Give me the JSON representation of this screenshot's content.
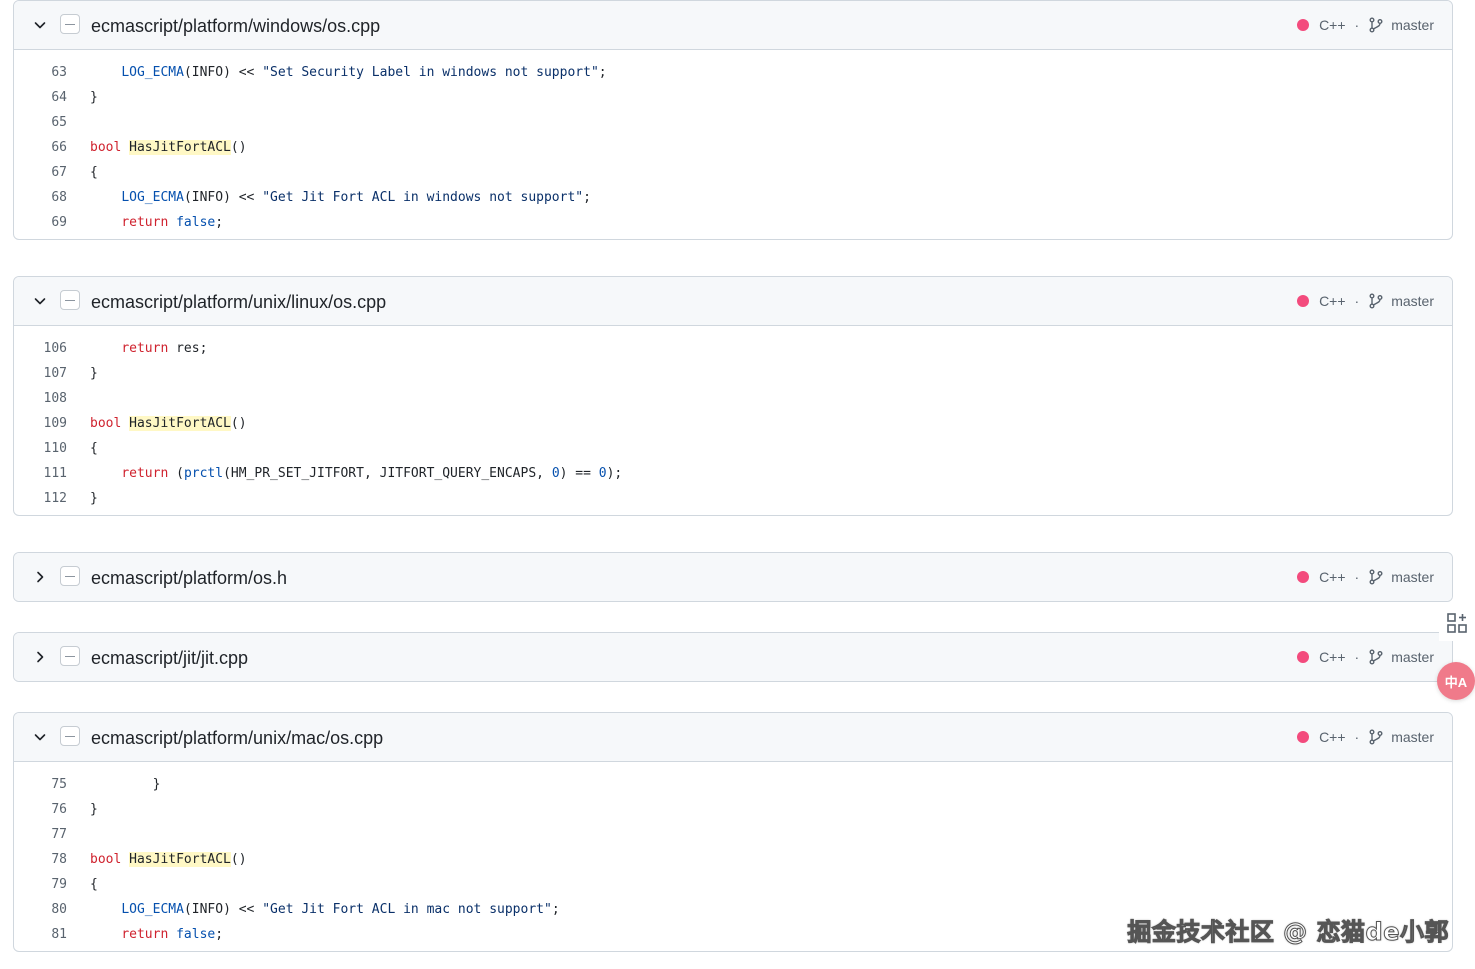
{
  "results": [
    {
      "path": "ecmascript/platform/windows/os.cpp",
      "language": "C++",
      "separator": "·",
      "branch": "master",
      "expanded": true,
      "lines": [
        {
          "n": "63",
          "indent": "    ",
          "tokens": [
            [
              "fn",
              "LOG_ECMA"
            ],
            [
              "",
              "(INFO) << "
            ],
            [
              "str",
              "\"Set Security Label in windows not support\""
            ],
            [
              "",
              ";"
            ]
          ]
        },
        {
          "n": "64",
          "indent": "",
          "tokens": [
            [
              "",
              "}"
            ]
          ]
        },
        {
          "n": "65",
          "indent": "",
          "tokens": []
        },
        {
          "n": "66",
          "indent": "",
          "tokens": [
            [
              "kw",
              "bool"
            ],
            [
              "",
              " "
            ],
            [
              "hl",
              "HasJitFortACL"
            ],
            [
              "",
              "()"
            ]
          ]
        },
        {
          "n": "67",
          "indent": "",
          "tokens": [
            [
              "",
              "{"
            ]
          ]
        },
        {
          "n": "68",
          "indent": "    ",
          "tokens": [
            [
              "fn",
              "LOG_ECMA"
            ],
            [
              "",
              "(INFO) << "
            ],
            [
              "str",
              "\"Get Jit Fort ACL in windows not support\""
            ],
            [
              "",
              ";"
            ]
          ]
        },
        {
          "n": "69",
          "indent": "    ",
          "tokens": [
            [
              "kw",
              "return"
            ],
            [
              "",
              " "
            ],
            [
              "fn",
              "false"
            ],
            [
              "",
              ";"
            ]
          ]
        }
      ]
    },
    {
      "path": "ecmascript/platform/unix/linux/os.cpp",
      "language": "C++",
      "separator": "·",
      "branch": "master",
      "expanded": true,
      "lines": [
        {
          "n": "106",
          "indent": "    ",
          "tokens": [
            [
              "kw",
              "return"
            ],
            [
              "",
              " res;"
            ]
          ]
        },
        {
          "n": "107",
          "indent": "",
          "tokens": [
            [
              "",
              "}"
            ]
          ]
        },
        {
          "n": "108",
          "indent": "",
          "tokens": []
        },
        {
          "n": "109",
          "indent": "",
          "tokens": [
            [
              "kw",
              "bool"
            ],
            [
              "",
              " "
            ],
            [
              "hl",
              "HasJitFortACL"
            ],
            [
              "",
              "()"
            ]
          ]
        },
        {
          "n": "110",
          "indent": "",
          "tokens": [
            [
              "",
              "{"
            ]
          ]
        },
        {
          "n": "111",
          "indent": "    ",
          "tokens": [
            [
              "kw",
              "return"
            ],
            [
              "",
              " ("
            ],
            [
              "fn",
              "prctl"
            ],
            [
              "",
              "(HM_PR_SET_JITFORT, JITFORT_QUERY_ENCAPS, "
            ],
            [
              "num",
              "0"
            ],
            [
              "",
              ") == "
            ],
            [
              "num",
              "0"
            ],
            [
              "",
              ");"
            ]
          ]
        },
        {
          "n": "112",
          "indent": "",
          "tokens": [
            [
              "",
              "}"
            ]
          ]
        }
      ]
    },
    {
      "path": "ecmascript/platform/os.h",
      "language": "C++",
      "separator": "·",
      "branch": "master",
      "expanded": false,
      "lines": []
    },
    {
      "path": "ecmascript/jit/jit.cpp",
      "language": "C++",
      "separator": "·",
      "branch": "master",
      "expanded": false,
      "lines": []
    },
    {
      "path": "ecmascript/platform/unix/mac/os.cpp",
      "language": "C++",
      "separator": "·",
      "branch": "master",
      "expanded": true,
      "lines": [
        {
          "n": "75",
          "indent": "        ",
          "tokens": [
            [
              "",
              "}"
            ]
          ]
        },
        {
          "n": "76",
          "indent": "",
          "tokens": [
            [
              "",
              "}"
            ]
          ]
        },
        {
          "n": "77",
          "indent": "",
          "tokens": []
        },
        {
          "n": "78",
          "indent": "",
          "tokens": [
            [
              "kw",
              "bool"
            ],
            [
              "",
              " "
            ],
            [
              "hl",
              "HasJitFortACL"
            ],
            [
              "",
              "()"
            ]
          ]
        },
        {
          "n": "79",
          "indent": "",
          "tokens": [
            [
              "",
              "{"
            ]
          ]
        },
        {
          "n": "80",
          "indent": "    ",
          "tokens": [
            [
              "fn",
              "LOG_ECMA"
            ],
            [
              "",
              "(INFO) << "
            ],
            [
              "str",
              "\"Get Jit Fort ACL in mac not support\""
            ],
            [
              "",
              ";"
            ]
          ]
        },
        {
          "n": "81",
          "indent": "    ",
          "tokens": [
            [
              "kw",
              "return"
            ],
            [
              "",
              " "
            ],
            [
              "fn",
              "false"
            ],
            [
              "",
              ";"
            ]
          ]
        }
      ]
    }
  ],
  "floating": {
    "translate_label": "中A"
  },
  "watermark": "掘金技术社区 @ 恋猫de小郭",
  "colors": {
    "cpp_dot": "#f34b7d",
    "header_bg": "#f6f8fa",
    "border": "#d0d7de"
  }
}
